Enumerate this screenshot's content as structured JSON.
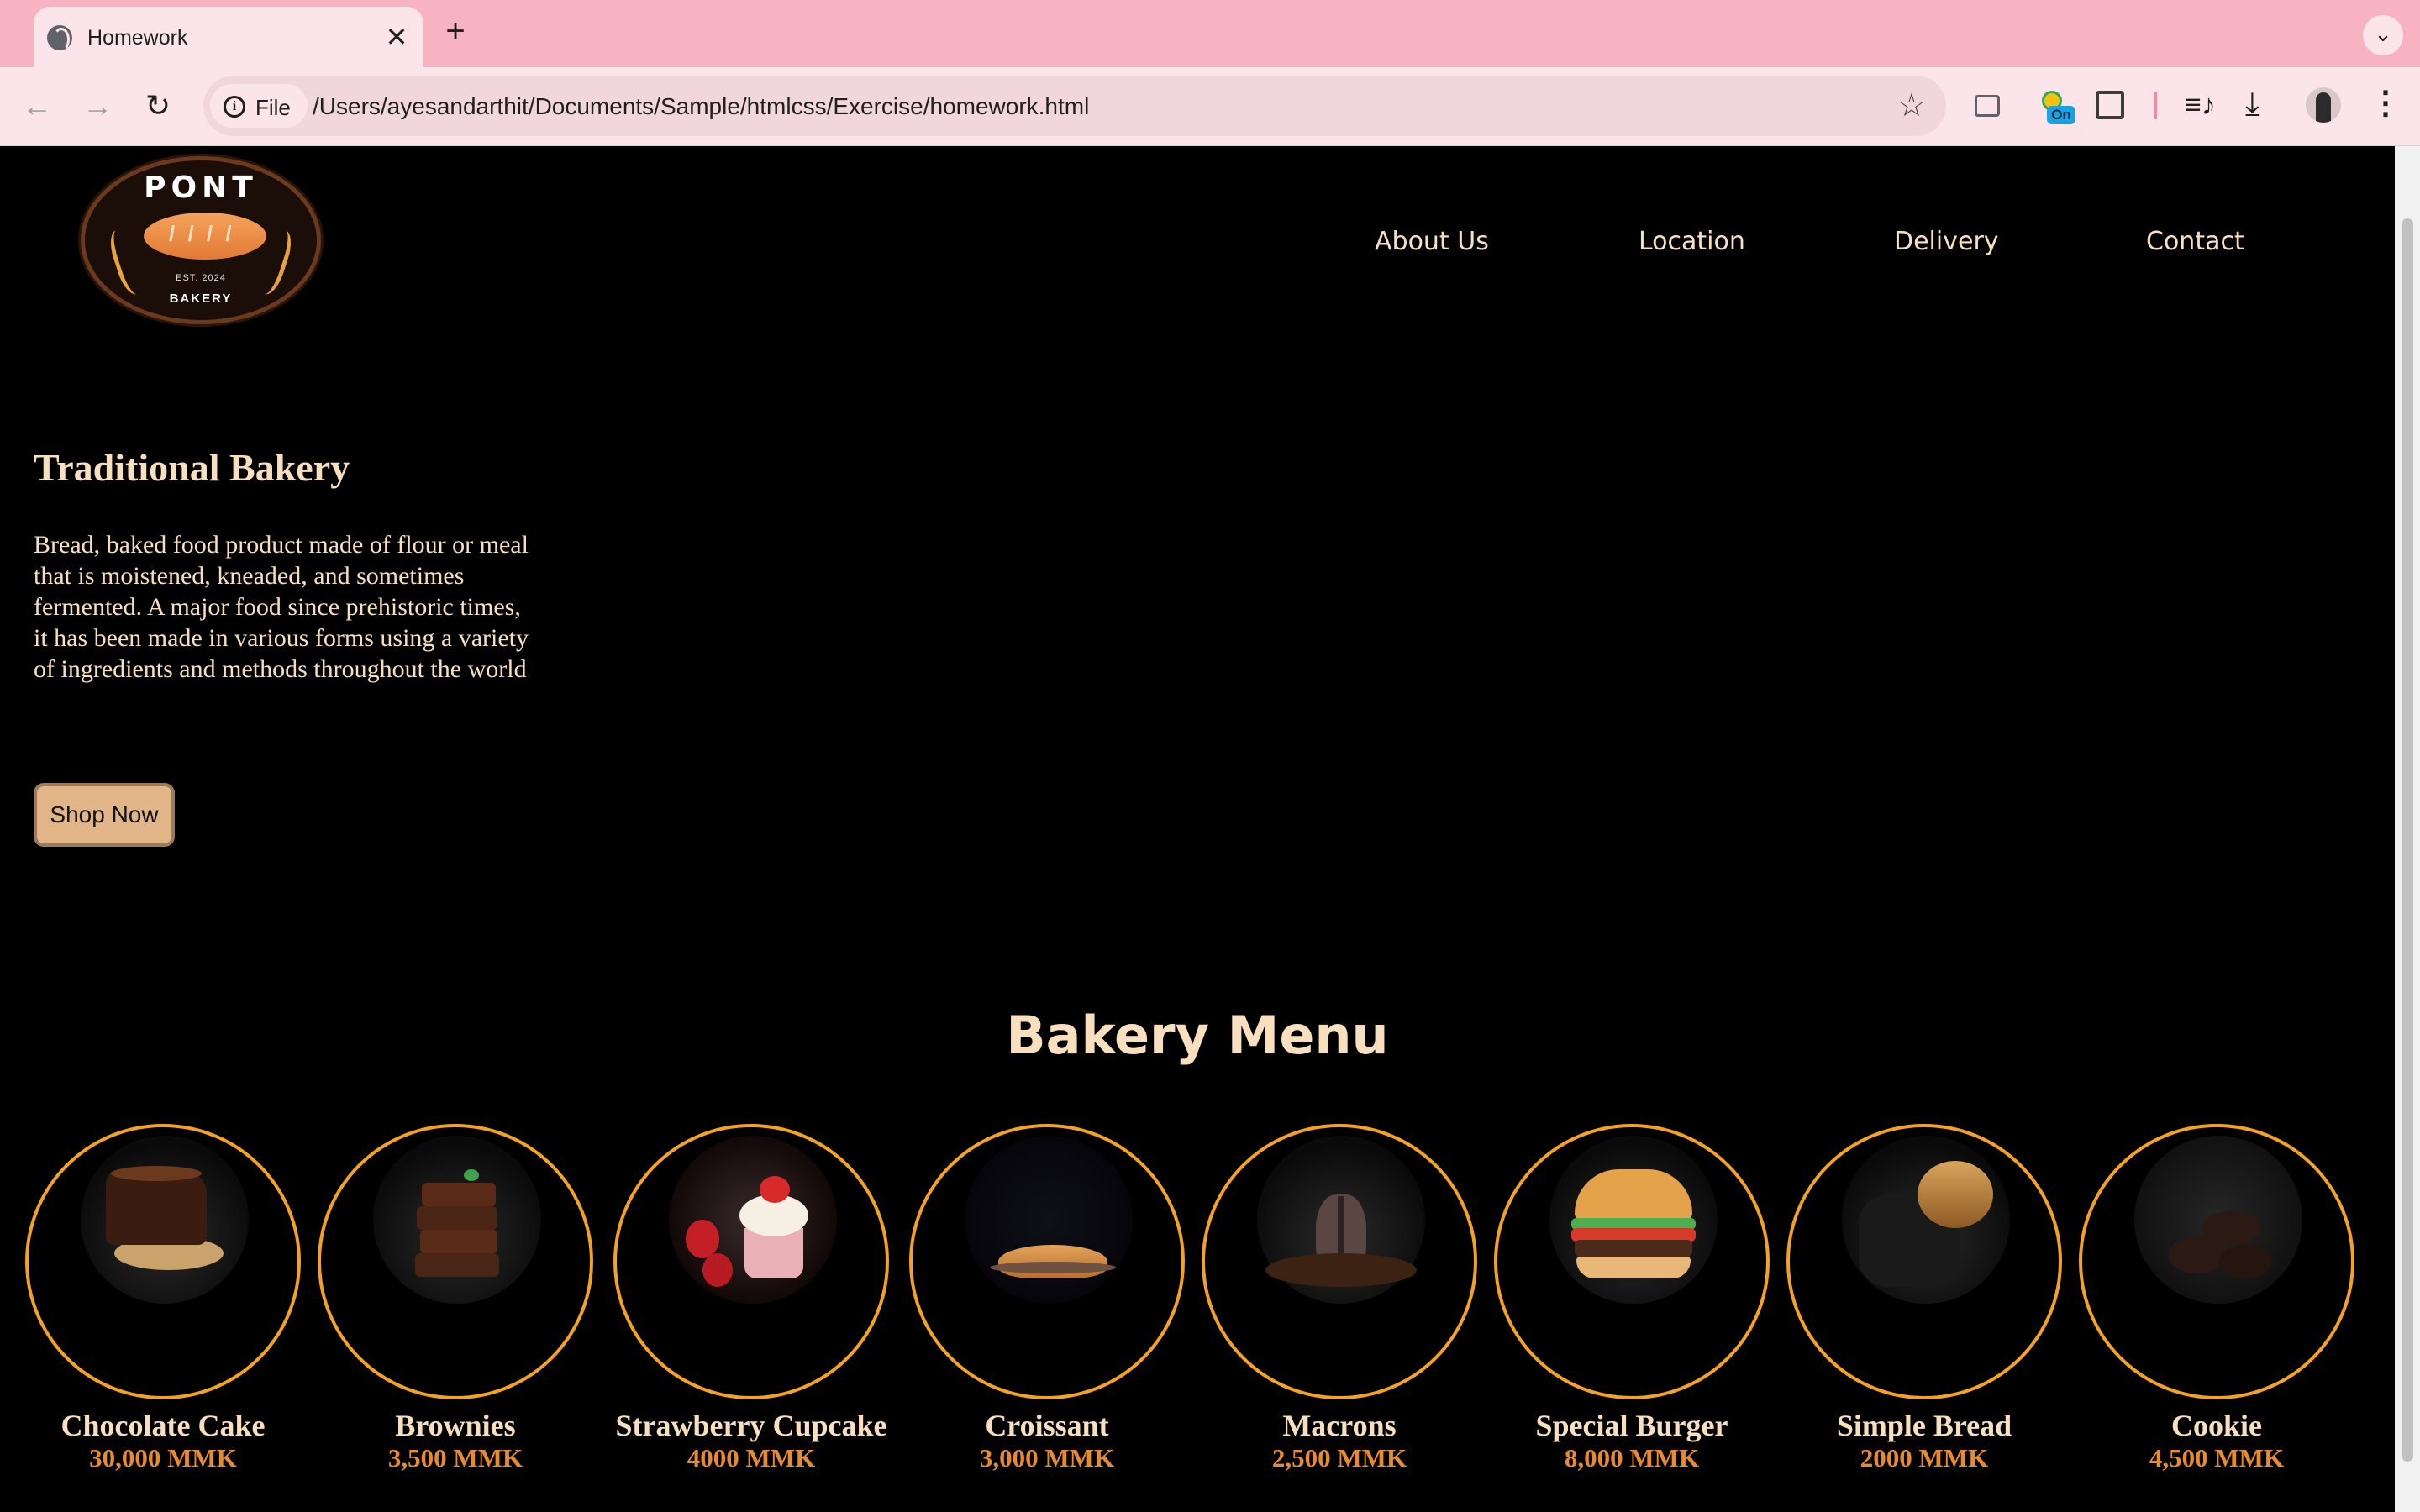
{
  "browser": {
    "tab_title": "Homework",
    "tab_close": "✕",
    "new_tab": "+",
    "tab_menu": "⌄",
    "back": "←",
    "forward": "→",
    "reload": "↻",
    "chip_label": "File",
    "chip_icon": "i",
    "url": "/Users/ayesandarthit/Documents/Sample/htmlcss/Exercise/homework.html",
    "bookmark": "☆",
    "extension_badge": "On",
    "media": "≡♪",
    "download": "⤓",
    "menu": "⋮",
    "icons": [
      "globe-icon",
      "info-icon",
      "star-icon",
      "cast-icon",
      "extension-icon",
      "puzzle-icon",
      "media-icon",
      "download-icon",
      "avatar",
      "kebab-icon"
    ]
  },
  "logo": {
    "top_text": "PONT",
    "est": "EST. 2024",
    "bottom_text": "BAKERY"
  },
  "nav": {
    "about": "About Us",
    "location": "Location",
    "delivery": "Delivery",
    "contact": "Contact"
  },
  "hero": {
    "title": "Traditional Bakery",
    "body": "Bread, baked food product made of flour or meal that is moistened, kneaded, and sometimes fermented. A major food since prehistoric times, it has been made in various forms using a variety of ingredients and methods throughout the world",
    "button": "Shop Now"
  },
  "menu": {
    "title": "Bakery Menu",
    "items": [
      {
        "name": "Chocolate Cake",
        "price": "30,000 MMK"
      },
      {
        "name": "Brownies",
        "price": "3,500 MMK"
      },
      {
        "name": "Strawberry Cupcake",
        "price": "4000 MMK"
      },
      {
        "name": "Croissant",
        "price": "3,000 MMK"
      },
      {
        "name": "Macrons",
        "price": "2,500 MMK"
      },
      {
        "name": "Special Burger",
        "price": "8,000 MMK"
      },
      {
        "name": "Simple Bread",
        "price": "2000 MMK"
      },
      {
        "name": "Cookie",
        "price": "4,500 MMK"
      }
    ]
  },
  "colors": {
    "chrome_tabbar": "#f8b3c3",
    "chrome_toolbar": "#fbe4ea",
    "page_bg": "#000000",
    "cream_text": "#f8e0be",
    "price_orange": "#e88a2e",
    "circle_border": "#f4a21f",
    "button_bg": "#e2b588"
  }
}
